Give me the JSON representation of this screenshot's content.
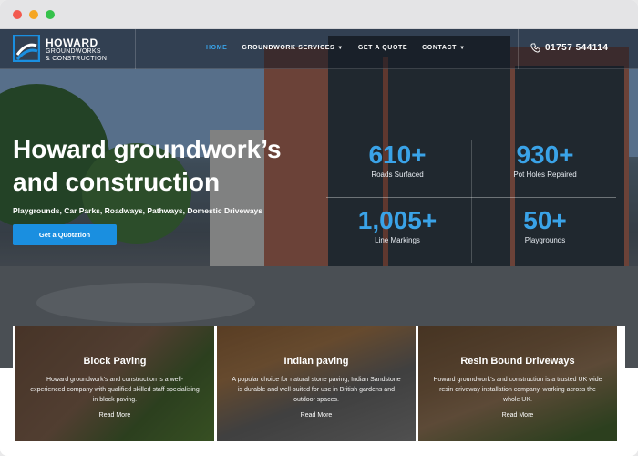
{
  "window": {
    "controls": [
      "close",
      "minimize",
      "maximize"
    ]
  },
  "brand": {
    "line1": "HOWARD",
    "line2": "GROUNDWORKS",
    "line3": "& CONSTRUCTION",
    "accent": "#1a8fe0"
  },
  "nav": {
    "items": [
      {
        "label": "HOME",
        "active": true,
        "dropdown": false
      },
      {
        "label": "GROUNDWORK SERVICES",
        "active": false,
        "dropdown": true
      },
      {
        "label": "GET A QUOTE",
        "active": false,
        "dropdown": false
      },
      {
        "label": "CONTACT",
        "active": false,
        "dropdown": true
      }
    ],
    "phone": "01757 544114"
  },
  "hero": {
    "title": "Howard groundwork’s and construction",
    "subtitle": "Playgrounds, Car Parks, Roadways, Pathways, Domestic Driveways",
    "cta": "Get a Quotation",
    "stats": [
      {
        "value": "610+",
        "label": "Roads Surfaced"
      },
      {
        "value": "930+",
        "label": "Pot Holes Repaired"
      },
      {
        "value": "1,005+",
        "label": "Line Markings"
      },
      {
        "value": "50+",
        "label": "Playgrounds"
      }
    ]
  },
  "cards": [
    {
      "title": "Block Paving",
      "text": "Howard groundwork’s and construction is a well-experienced company with qualified skilled staff specialising in block paving.",
      "link": "Read More"
    },
    {
      "title": "Indian paving",
      "text": "A popular choice for natural stone paving, Indian Sandstone is durable and well-suited for use in British gardens and outdoor spaces.",
      "link": "Read More"
    },
    {
      "title": "Resin Bound Driveways",
      "text": "Howard groundwork’s and construction is a trusted UK wide resin driveway installation company, working across the whole UK.",
      "link": "Read More"
    }
  ]
}
